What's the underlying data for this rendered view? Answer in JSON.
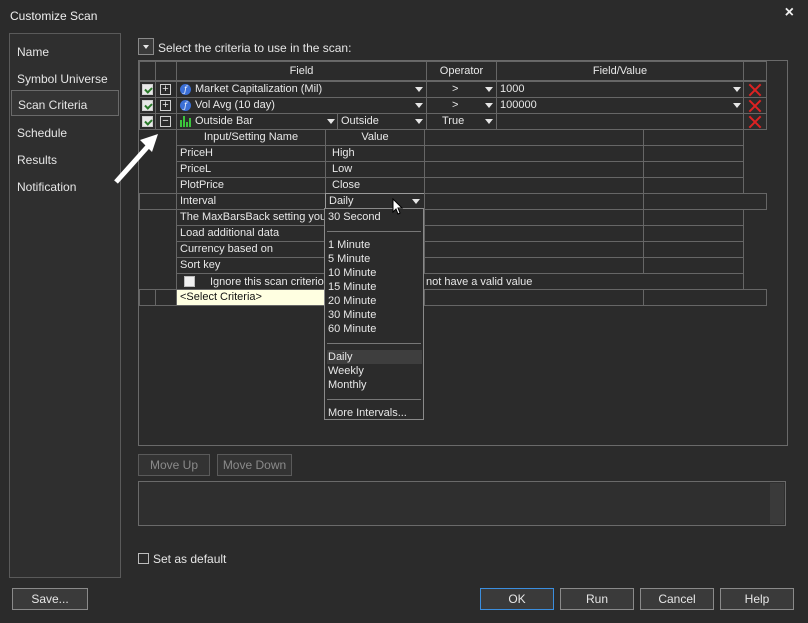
{
  "window": {
    "title": "Customize Scan",
    "close_glyph": "×"
  },
  "sidebar": {
    "items": [
      {
        "label": "Name"
      },
      {
        "label": "Symbol Universe"
      },
      {
        "label": "Scan Criteria"
      },
      {
        "label": "Schedule"
      },
      {
        "label": "Results"
      },
      {
        "label": "Notification"
      }
    ],
    "active": "Scan Criteria"
  },
  "criteria": {
    "instruction": "Select the criteria to use in the scan:"
  },
  "grid": {
    "columns": {
      "field": "Field",
      "operator": "Operator",
      "value": "Field/Value"
    },
    "rows": [
      {
        "field": "Market Capitalization (Mil)",
        "operator": ">",
        "value": "1000",
        "checked": true,
        "toggle": "+",
        "icon": "fx-icon"
      },
      {
        "field": "Vol Avg (10 day)",
        "operator": ">",
        "value": "100000",
        "checked": true,
        "toggle": "+",
        "icon": "fx-icon"
      },
      {
        "field": "Outside Bar",
        "field2": "Outside",
        "operator": "True",
        "value": "",
        "checked": true,
        "toggle": "−",
        "icon": "bars-icon"
      }
    ],
    "sub_columns": {
      "name": "Input/Setting Name",
      "value": "Value"
    },
    "sub_rows": [
      {
        "name": "PriceH",
        "value": "High"
      },
      {
        "name": "PriceL",
        "value": "Low"
      },
      {
        "name": "PlotPrice",
        "value": "Close"
      },
      {
        "name": "Interval",
        "value": "Daily"
      },
      {
        "name": "The MaxBarsBack setting you",
        "value": ""
      },
      {
        "name": "Load additional data",
        "value": ""
      },
      {
        "name": "Currency based on",
        "value": ""
      },
      {
        "name": "Sort key",
        "value": ""
      }
    ],
    "ignore_text_left": "Ignore this scan criterion",
    "ignore_text_right": "not have a valid value",
    "select_criteria": "<Select Criteria>"
  },
  "interval_dropdown": {
    "groups": [
      [
        "30 Second"
      ],
      [
        "1 Minute",
        "5 Minute",
        "10 Minute",
        "15 Minute",
        "20 Minute",
        "30 Minute",
        "60 Minute"
      ],
      [
        "Daily",
        "Weekly",
        "Monthly"
      ],
      [
        "More Intervals..."
      ]
    ],
    "selected": "Daily"
  },
  "actions": {
    "move_up": "Move Up",
    "move_down": "Move Down"
  },
  "set_default": {
    "label": "Set as default",
    "checked": false
  },
  "footer": {
    "save": "Save...",
    "ok": "OK",
    "run": "Run",
    "cancel": "Cancel",
    "help": "Help"
  },
  "colors": {
    "background": "#2b2b2b",
    "accent": "#3b8ede",
    "delete": "#d22222",
    "tooltip": "#ffffe1"
  }
}
